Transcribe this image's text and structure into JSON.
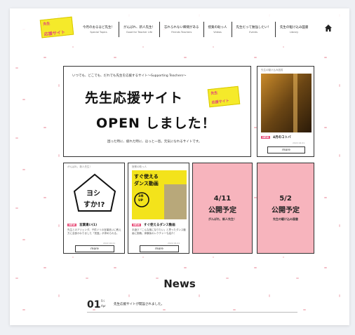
{
  "header": {
    "logo": {
      "line1": "先生",
      "line2": "応援サイト"
    },
    "nav": [
      {
        "jp": "今月のおるほど先生！",
        "en": "Special Topics"
      },
      {
        "jp": "がんばれ、新人先生！",
        "en": "Good for Teacher Life"
      },
      {
        "jp": "忘れられない瞬間がある",
        "en": "Friends Teachers"
      },
      {
        "jp": "授業の助っ人",
        "en": "Videos"
      },
      {
        "jp": "先生だって勉強したい！",
        "en": "Events"
      },
      {
        "jp": "先生の駆け込み図書",
        "en": "Library"
      }
    ]
  },
  "hero": {
    "tagline": "いつでも、どこでも、だれでも先生を応援するサイト～Supporting Teachers～",
    "headline1": "先生応援サイト",
    "headline2": "OPEN しました！",
    "footer": "困った時に、疲れた時に、ほっと一息。元気になれるサイトです。",
    "badge1": "先生",
    "badge2": "応援サイト"
  },
  "side_card": {
    "category": "先生の駆け込み図書",
    "new_label": "NEW",
    "title": "4月のコトバ",
    "date": "2022.04.01",
    "more": "more"
  },
  "cards": [
    {
      "category": "がんばれ、新人先生！",
      "new_label": "NEW",
      "title": "言葉遣い(1)",
      "desc": "先生とのアジェンダ、子供ソリの言葉遣いに教え方に全部かわりました「見直」が求められる。",
      "date": "2022.04.01",
      "more": "more",
      "thumb_text1": "ヨシ",
      "thumb_text2": "すか!?"
    },
    {
      "category": "授業の助っ人",
      "new_label": "NEW",
      "title": "すぐ使えるダンス動画",
      "desc": "手遊び「こんな風になりたい」と思ったダンス動画に挑戦。体験後のレクチャーも紹介！",
      "date": "2022.04.01",
      "more": "more",
      "thumb_text1": "すぐ使える",
      "thumb_text2": "ダンス動画",
      "thumb_text3": "3本",
      "thumb_text4": "UP"
    }
  ],
  "upcoming": [
    {
      "date": "4/11",
      "label": "公開予定",
      "sub": "がんばれ、新人先生！"
    },
    {
      "date": "5/2",
      "label": "公開予定",
      "sub": "先生の駆け込み図書"
    }
  ],
  "news": {
    "heading": "News",
    "items": [
      {
        "day": "01",
        "dow": "Fri",
        "month": "Apr",
        "text": "先生応援サイトが開設されました。"
      }
    ]
  },
  "colors": {
    "pink": "#f7b4bd",
    "yellow": "#f5ea2a",
    "accent": "#e8517b"
  },
  "icons": {
    "home": "home-icon"
  }
}
